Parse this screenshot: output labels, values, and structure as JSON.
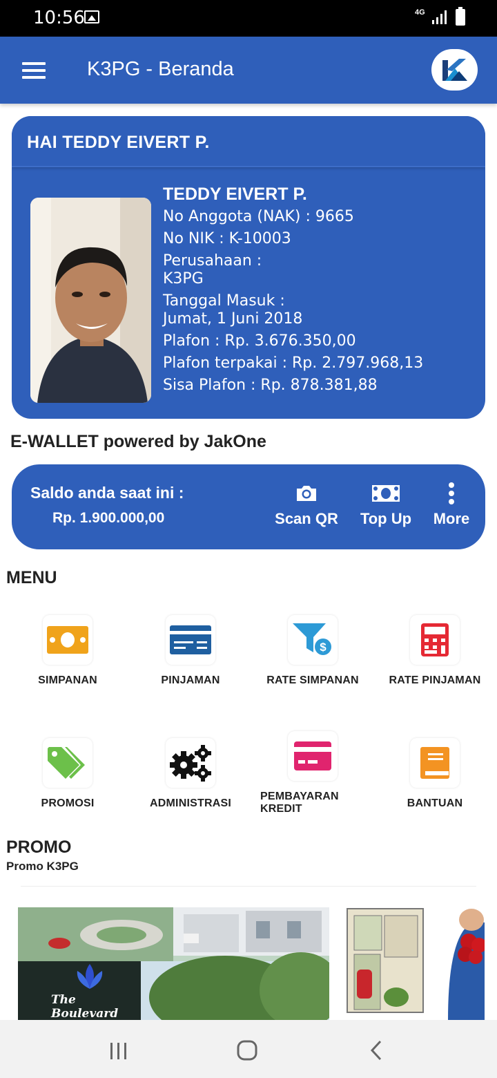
{
  "status_bar": {
    "time": "10:56",
    "network": "4G"
  },
  "app_bar": {
    "title": "K3PG - Beranda"
  },
  "profile": {
    "greeting": "HAI TEDDY EIVERT P.",
    "name": "TEDDY EIVERT P.",
    "member_no": "No Anggota (NAK) : 9665",
    "nik": "No NIK : K-10003",
    "company_label": "Perusahaan :",
    "company": "K3PG",
    "join_label": "Tanggal Masuk :",
    "join_date": "Jumat, 1 Juni 2018",
    "plafon": "Plafon : Rp. 3.676.350,00",
    "plafon_used": "Plafon terpakai : Rp. 2.797.968,13",
    "plafon_remaining": "Sisa Plafon : Rp. 878.381,88"
  },
  "ewallet": {
    "title": "E-WALLET powered by JakOne",
    "balance_label": "Saldo anda saat ini :",
    "balance": "Rp. 1.900.000,00",
    "actions": [
      {
        "label": "Scan QR",
        "icon": "camera-icon"
      },
      {
        "label": "Top Up",
        "icon": "cash-icon"
      },
      {
        "label": "More",
        "icon": "more-vert-icon"
      }
    ]
  },
  "menu": {
    "title": "MENU",
    "items": [
      {
        "label": "SIMPANAN",
        "icon": "money-icon",
        "color": "#f0a31b"
      },
      {
        "label": "PINJAMAN",
        "icon": "card-icon",
        "color": "#1f5fa0"
      },
      {
        "label": "RATE SIMPANAN",
        "icon": "funnel-dollar-icon",
        "color": "#2d9ad6"
      },
      {
        "label": "RATE PINJAMAN",
        "icon": "calculator-icon",
        "color": "#e52934"
      },
      {
        "label": "PROMOSI",
        "icon": "tags-icon",
        "color": "#6cc04a"
      },
      {
        "label": "ADMINISTRASI",
        "icon": "gears-icon",
        "color": "#111111"
      },
      {
        "label": "PEMBAYARAN KREDIT",
        "icon": "credit-card-icon",
        "color": "#e0246e"
      },
      {
        "label": "BANTUAN",
        "icon": "book-icon",
        "color": "#f39322"
      }
    ]
  },
  "promo": {
    "title": "PROMO",
    "subtitle": "Promo K3PG",
    "banners": [
      {
        "text": "The Boulevard"
      },
      {
        "text": ""
      }
    ]
  },
  "colors": {
    "primary": "#2f5fba",
    "status_bar": "#000000",
    "nav_bar": "#f2f2f2"
  }
}
